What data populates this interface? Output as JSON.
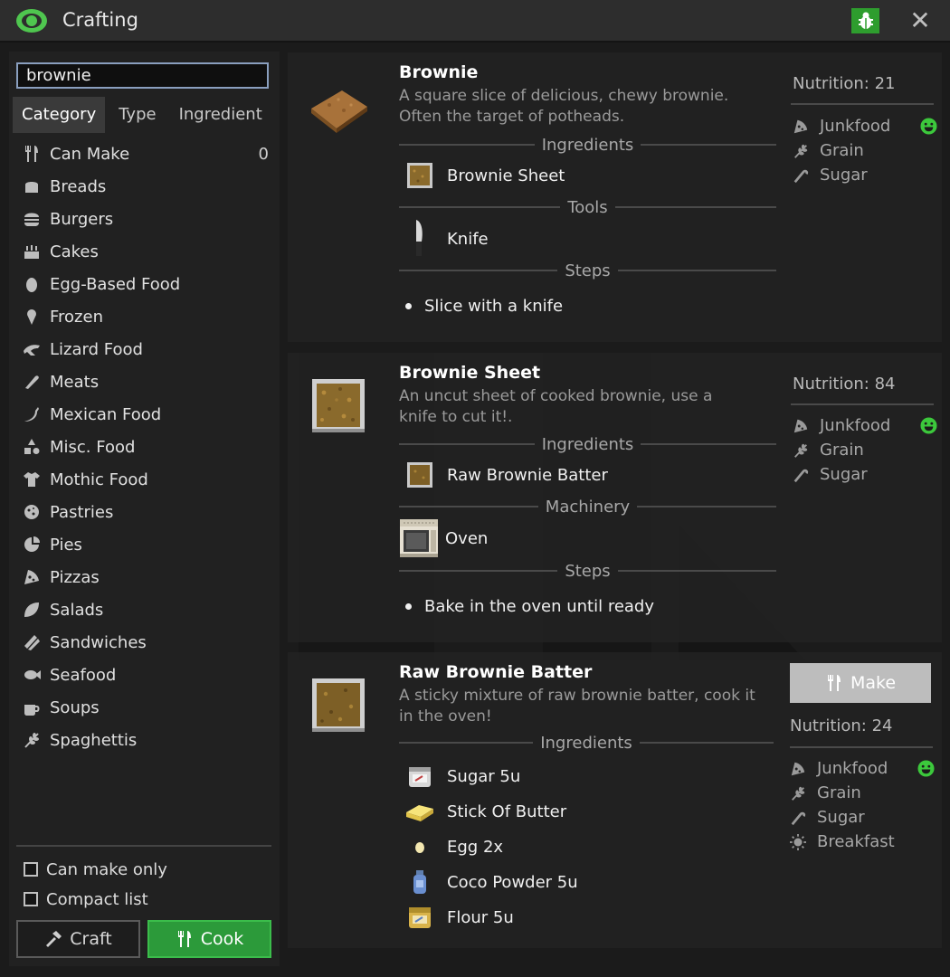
{
  "window": {
    "title": "Crafting",
    "icons": {
      "logo": "eye-icon",
      "bug": "bug-icon",
      "close": "close-icon"
    }
  },
  "search": {
    "value": "brownie"
  },
  "tabs": [
    "Category",
    "Type",
    "Ingredient"
  ],
  "categories": [
    {
      "label": "Can Make",
      "icon": "utensils-icon",
      "count": "0"
    },
    {
      "label": "Breads",
      "icon": "bread-icon"
    },
    {
      "label": "Burgers",
      "icon": "burger-icon"
    },
    {
      "label": "Cakes",
      "icon": "cake-icon"
    },
    {
      "label": "Egg-Based Food",
      "icon": "egg-icon"
    },
    {
      "label": "Frozen",
      "icon": "ice-cream-icon"
    },
    {
      "label": "Lizard Food",
      "icon": "lizard-icon"
    },
    {
      "label": "Meats",
      "icon": "meat-icon"
    },
    {
      "label": "Mexican Food",
      "icon": "pepper-icon"
    },
    {
      "label": "Misc. Food",
      "icon": "shapes-icon"
    },
    {
      "label": "Mothic Food",
      "icon": "shirt-icon"
    },
    {
      "label": "Pastries",
      "icon": "cookie-icon"
    },
    {
      "label": "Pies",
      "icon": "pie-icon"
    },
    {
      "label": "Pizzas",
      "icon": "pizza-icon"
    },
    {
      "label": "Salads",
      "icon": "leaf-icon"
    },
    {
      "label": "Sandwiches",
      "icon": "bacon-icon"
    },
    {
      "label": "Seafood",
      "icon": "fish-icon"
    },
    {
      "label": "Soups",
      "icon": "mug-icon"
    },
    {
      "label": "Spaghettis",
      "icon": "wheat-icon"
    }
  ],
  "options": {
    "can_make_only": "Can make only",
    "compact_list": "Compact list"
  },
  "buttons": {
    "craft": "Craft",
    "cook": "Cook"
  },
  "section_labels": {
    "ingredients": "Ingredients",
    "tools": "Tools",
    "steps": "Steps",
    "machinery": "Machinery"
  },
  "recipes": [
    {
      "name": "Brownie",
      "description": "A square slice of delicious, chewy brownie. Often the target of potheads.",
      "nutrition": "Nutrition: 21",
      "ingredients": [
        {
          "label": "Brownie Sheet",
          "icon": "brownie-sheet-icon"
        }
      ],
      "tools": [
        {
          "label": "Knife",
          "icon": "knife-icon"
        }
      ],
      "steps": [
        "Slice with a knife"
      ],
      "flavors": [
        "Junkfood",
        "Grain",
        "Sugar"
      ]
    },
    {
      "name": "Brownie Sheet",
      "description": "An uncut sheet of cooked brownie, use a knife to cut it!.",
      "nutrition": "Nutrition: 84",
      "ingredients": [
        {
          "label": "Raw Brownie Batter",
          "icon": "batter-icon"
        }
      ],
      "machinery": [
        {
          "label": "Oven",
          "icon": "oven-icon"
        }
      ],
      "steps": [
        "Bake in the oven until ready"
      ],
      "flavors": [
        "Junkfood",
        "Grain",
        "Sugar"
      ]
    },
    {
      "name": "Raw Brownie Batter",
      "description": "A sticky mixture of raw brownie batter, cook it in the oven!",
      "nutrition": "Nutrition: 24",
      "make_label": "Make",
      "ingredients": [
        {
          "label": "Sugar 5u",
          "icon": "sugar-bag-icon"
        },
        {
          "label": "Stick Of Butter",
          "icon": "butter-icon"
        },
        {
          "label": "Egg 2x",
          "icon": "egg-icon"
        },
        {
          "label": "Coco Powder 5u",
          "icon": "shaker-icon"
        },
        {
          "label": "Flour 5u",
          "icon": "flour-bag-icon"
        }
      ],
      "flavors": [
        "Junkfood",
        "Grain",
        "Sugar",
        "Breakfast"
      ]
    }
  ],
  "colors": {
    "accent_green": "#2c9a3a",
    "smiley_green": "#3cc83c",
    "eye_green": "#4fc64f"
  }
}
